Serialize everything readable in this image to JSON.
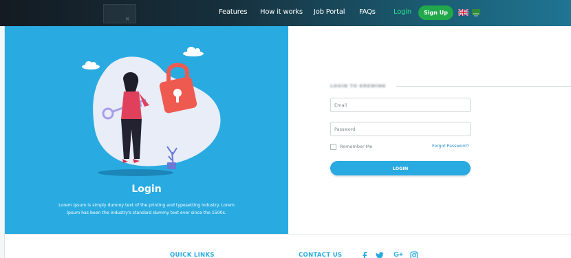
{
  "nav": {
    "links": [
      {
        "label": "Features"
      },
      {
        "label": "How it works"
      },
      {
        "label": "Job Portal"
      },
      {
        "label": "FAQs"
      },
      {
        "label": "Login"
      }
    ],
    "signup_label": "Sign Up",
    "ghost_close": "×"
  },
  "hero": {
    "title": "Login",
    "description": "Lorem Ipsum is simply dummy text of the printing and typesetting industry. Lorem Ipsum has been the industry's standard dummy text ever since the 1500s."
  },
  "form": {
    "heading": "LOGIN TO KREWINK",
    "email_placeholder": "Email",
    "password_placeholder": "Password",
    "remember_label": "Remember Me",
    "forgot_label": "Forgot Password?",
    "submit_label": "LOGIN"
  },
  "footer": {
    "quick_links": "QUICK LINKS",
    "contact": "CONTACT US",
    "social_icons": [
      "facebook-icon",
      "twitter-icon",
      "google-plus-icon",
      "instagram-icon"
    ]
  },
  "colors": {
    "brand_blue": "#29abe2",
    "signup_green": "#21a84a",
    "active_link": "#2ee089"
  }
}
